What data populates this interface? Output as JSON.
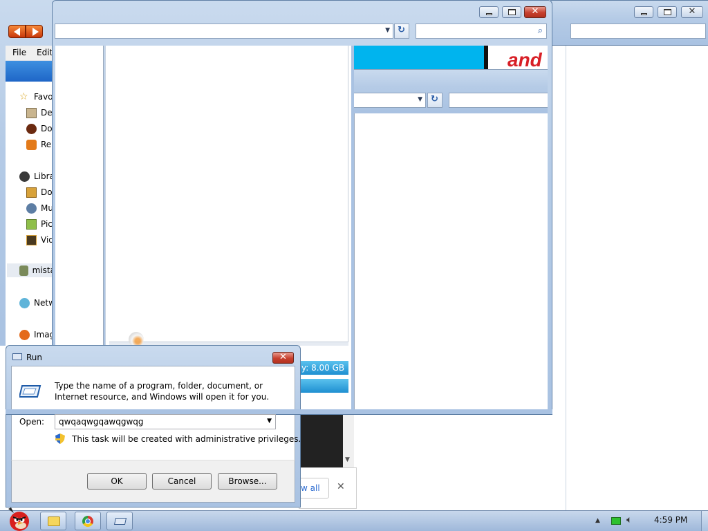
{
  "explorer_back": {
    "menu": [
      "File",
      "Edit"
    ],
    "nav": {
      "favorites": "Favo",
      "fav_items": [
        "De",
        "Do",
        "Re"
      ],
      "libraries": "Libra",
      "lib_items": [
        "Do",
        "Mu",
        "Pic",
        "Vid"
      ],
      "homegroup": "mista",
      "network": "Netw",
      "extra": "Imag"
    }
  },
  "browser_front": {
    "banner_text": "and",
    "memory_text": "y: 8.00 GB"
  },
  "notification": {
    "view_all": "w all",
    "close_glyph": "✕"
  },
  "run_dialog": {
    "title": "Run",
    "description": "Type the name of a program, folder, document, or Internet resource, and Windows will open it for you.",
    "open_label": "Open:",
    "open_value": "qwqaqwgqawqgwqg",
    "admin_note": "This task will be created with administrative privileges.",
    "ok": "OK",
    "cancel": "Cancel",
    "browse": "Browse..."
  },
  "taskbar": {
    "clock": "4:59 PM"
  },
  "colors": {
    "aero_frame": "#b5cbe6",
    "accent_blue": "#00b4ee",
    "banner_red": "#d81f26",
    "close_red": "#c7402e"
  }
}
